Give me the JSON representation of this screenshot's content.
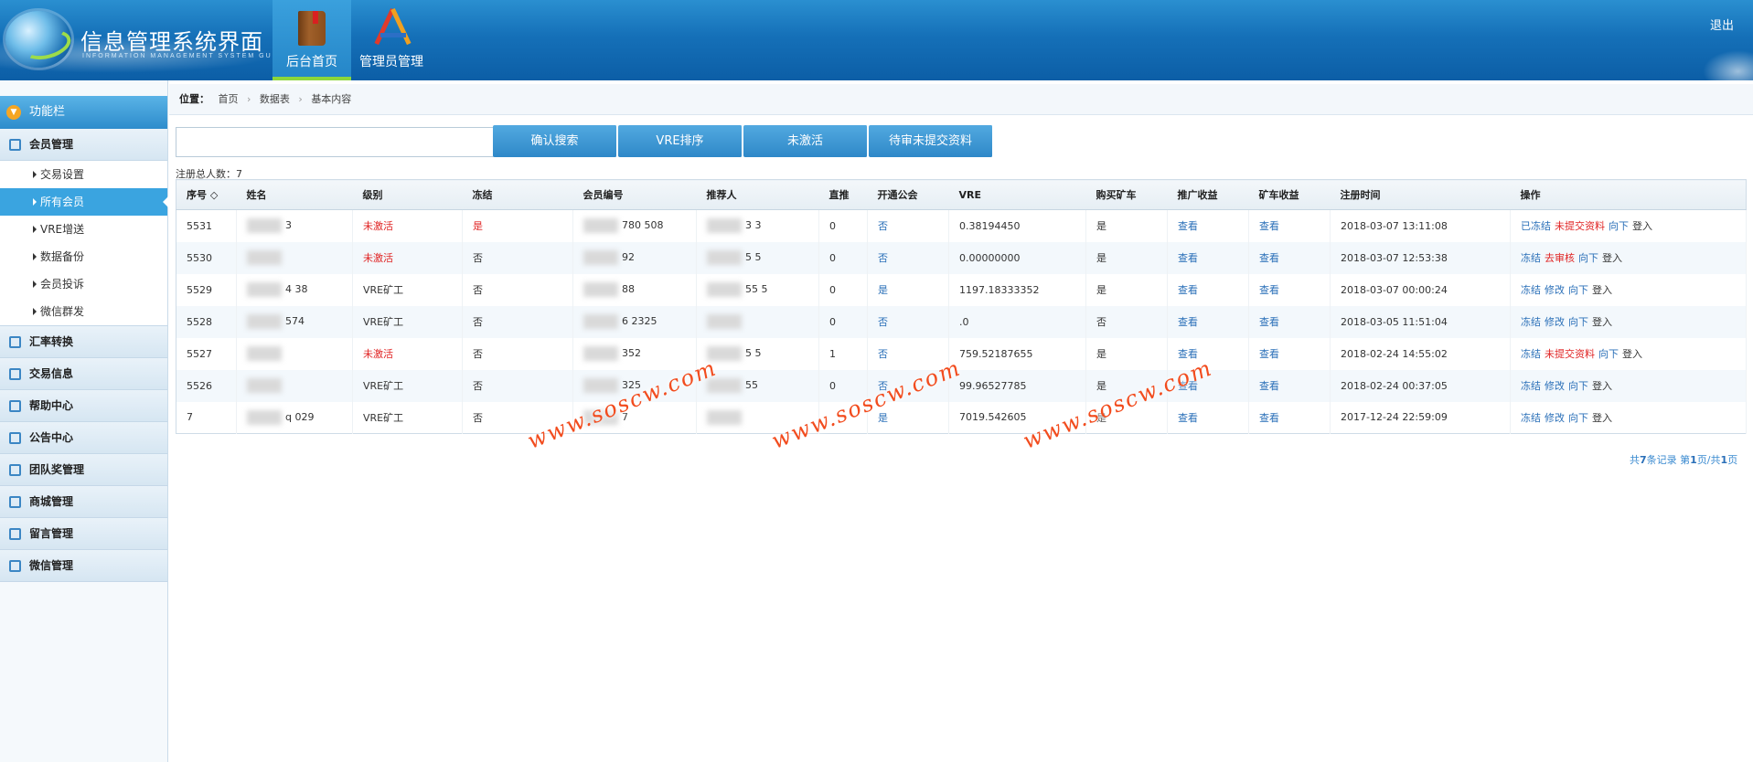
{
  "header": {
    "title": "信息管理系统界面",
    "subtitle": "INFORMATION MANAGEMENT SYSTEM GUI",
    "nav": [
      {
        "label": "后台首页",
        "icon": "book-icon"
      },
      {
        "label": "管理员管理",
        "icon": "admin-tools-icon"
      }
    ],
    "logout_label": "退出"
  },
  "sidebar": {
    "title": "功能栏",
    "groups": [
      {
        "label": "会员管理"
      },
      {
        "label": "汇率转换"
      },
      {
        "label": "交易信息"
      },
      {
        "label": "帮助中心"
      },
      {
        "label": "公告中心"
      },
      {
        "label": "团队奖管理"
      },
      {
        "label": "商城管理"
      },
      {
        "label": "留言管理"
      },
      {
        "label": "微信管理"
      }
    ],
    "sub_items": [
      {
        "label": "交易设置"
      },
      {
        "label": "所有会员"
      },
      {
        "label": "VRE增送"
      },
      {
        "label": "数据备份"
      },
      {
        "label": "会员投诉"
      },
      {
        "label": "微信群发"
      }
    ]
  },
  "breadcrumb": {
    "label": "位置：",
    "items": [
      "首页",
      "数据表",
      "基本内容"
    ]
  },
  "toolbar": {
    "search_value": "",
    "buttons": [
      "确认搜索",
      "VRE排序",
      "未激活",
      "待审未提交资料"
    ]
  },
  "total_label": "注册总人数：7",
  "table": {
    "headers": [
      "序号",
      "姓名",
      "级别",
      "冻结",
      "会员编号",
      "推荐人",
      "直推",
      "开通公会",
      "VRE",
      "购买矿车",
      "推广收益",
      "矿车收益",
      "注册时间",
      "操作"
    ],
    "rows": [
      {
        "id": "5531",
        "name": "3",
        "level": "未激活",
        "frozen": "是",
        "member_no": "780 508",
        "referrer": "3 3",
        "direct": "0",
        "guild": "否",
        "vre": "0.38194450",
        "cart": "是",
        "promo": "查看",
        "cart_income": "查看",
        "time": "2018-03-07 13:11:08",
        "ops": [
          "已冻结",
          "未提交资料",
          "向下",
          "登入"
        ]
      },
      {
        "id": "5530",
        "name": "",
        "level": "未激活",
        "frozen": "否",
        "member_no": "92",
        "referrer": "5 5",
        "direct": "0",
        "guild": "否",
        "vre": "0.00000000",
        "cart": "是",
        "promo": "查看",
        "cart_income": "查看",
        "time": "2018-03-07 12:53:38",
        "ops": [
          "冻结",
          "去审核",
          "向下",
          "登入"
        ]
      },
      {
        "id": "5529",
        "name": "4 38",
        "level": "VRE矿工",
        "frozen": "否",
        "member_no": "88",
        "referrer": "55 5",
        "direct": "0",
        "guild": "是",
        "vre": "1197.18333352",
        "cart": "是",
        "promo": "查看",
        "cart_income": "查看",
        "time": "2018-03-07 00:00:24",
        "ops": [
          "冻结",
          "修改",
          "向下",
          "登入"
        ]
      },
      {
        "id": "5528",
        "name": "574",
        "level": "VRE矿工",
        "frozen": "否",
        "member_no": "6 2325",
        "referrer": "",
        "direct": "0",
        "guild": "否",
        "vre": ".0",
        "cart": "否",
        "promo": "查看",
        "cart_income": "查看",
        "time": "2018-03-05 11:51:04",
        "ops": [
          "冻结",
          "修改",
          "向下",
          "登入"
        ]
      },
      {
        "id": "5527",
        "name": "",
        "level": "未激活",
        "frozen": "否",
        "member_no": "352",
        "referrer": "5 5",
        "direct": "1",
        "guild": "否",
        "vre": "759.52187655",
        "cart": "是",
        "promo": "查看",
        "cart_income": "查看",
        "time": "2018-02-24 14:55:02",
        "ops": [
          "冻结",
          "未提交资料",
          "向下",
          "登入"
        ]
      },
      {
        "id": "5526",
        "name": "",
        "level": "VRE矿工",
        "frozen": "否",
        "member_no": "325",
        "referrer": "55",
        "direct": "0",
        "guild": "否",
        "vre": "99.96527785",
        "cart": "是",
        "promo": "查看",
        "cart_income": "查看",
        "time": "2018-02-24 00:37:05",
        "ops": [
          "冻结",
          "修改",
          "向下",
          "登入"
        ]
      },
      {
        "id": "7",
        "name": "q 029",
        "level": "VRE矿工",
        "frozen": "否",
        "member_no": "7",
        "referrer": "",
        "direct": "",
        "guild": "是",
        "vre": "7019.542605",
        "cart": "是",
        "promo": "查看",
        "cart_income": "查看",
        "time": "2017-12-24 22:59:09",
        "ops": [
          "冻结",
          "修改",
          "向下",
          "登入"
        ]
      }
    ]
  },
  "pager": {
    "text_prefix": "共",
    "count": "7",
    "text_mid": "条记录 第",
    "page": "1",
    "text_sep": "页/共",
    "pages": "1",
    "text_suffix": "页"
  },
  "watermark": "www.soscw.com",
  "colors": {
    "header": "#1570b8",
    "accent": "#3aa4e0",
    "danger": "#e02424",
    "link": "#2a6fb8"
  }
}
